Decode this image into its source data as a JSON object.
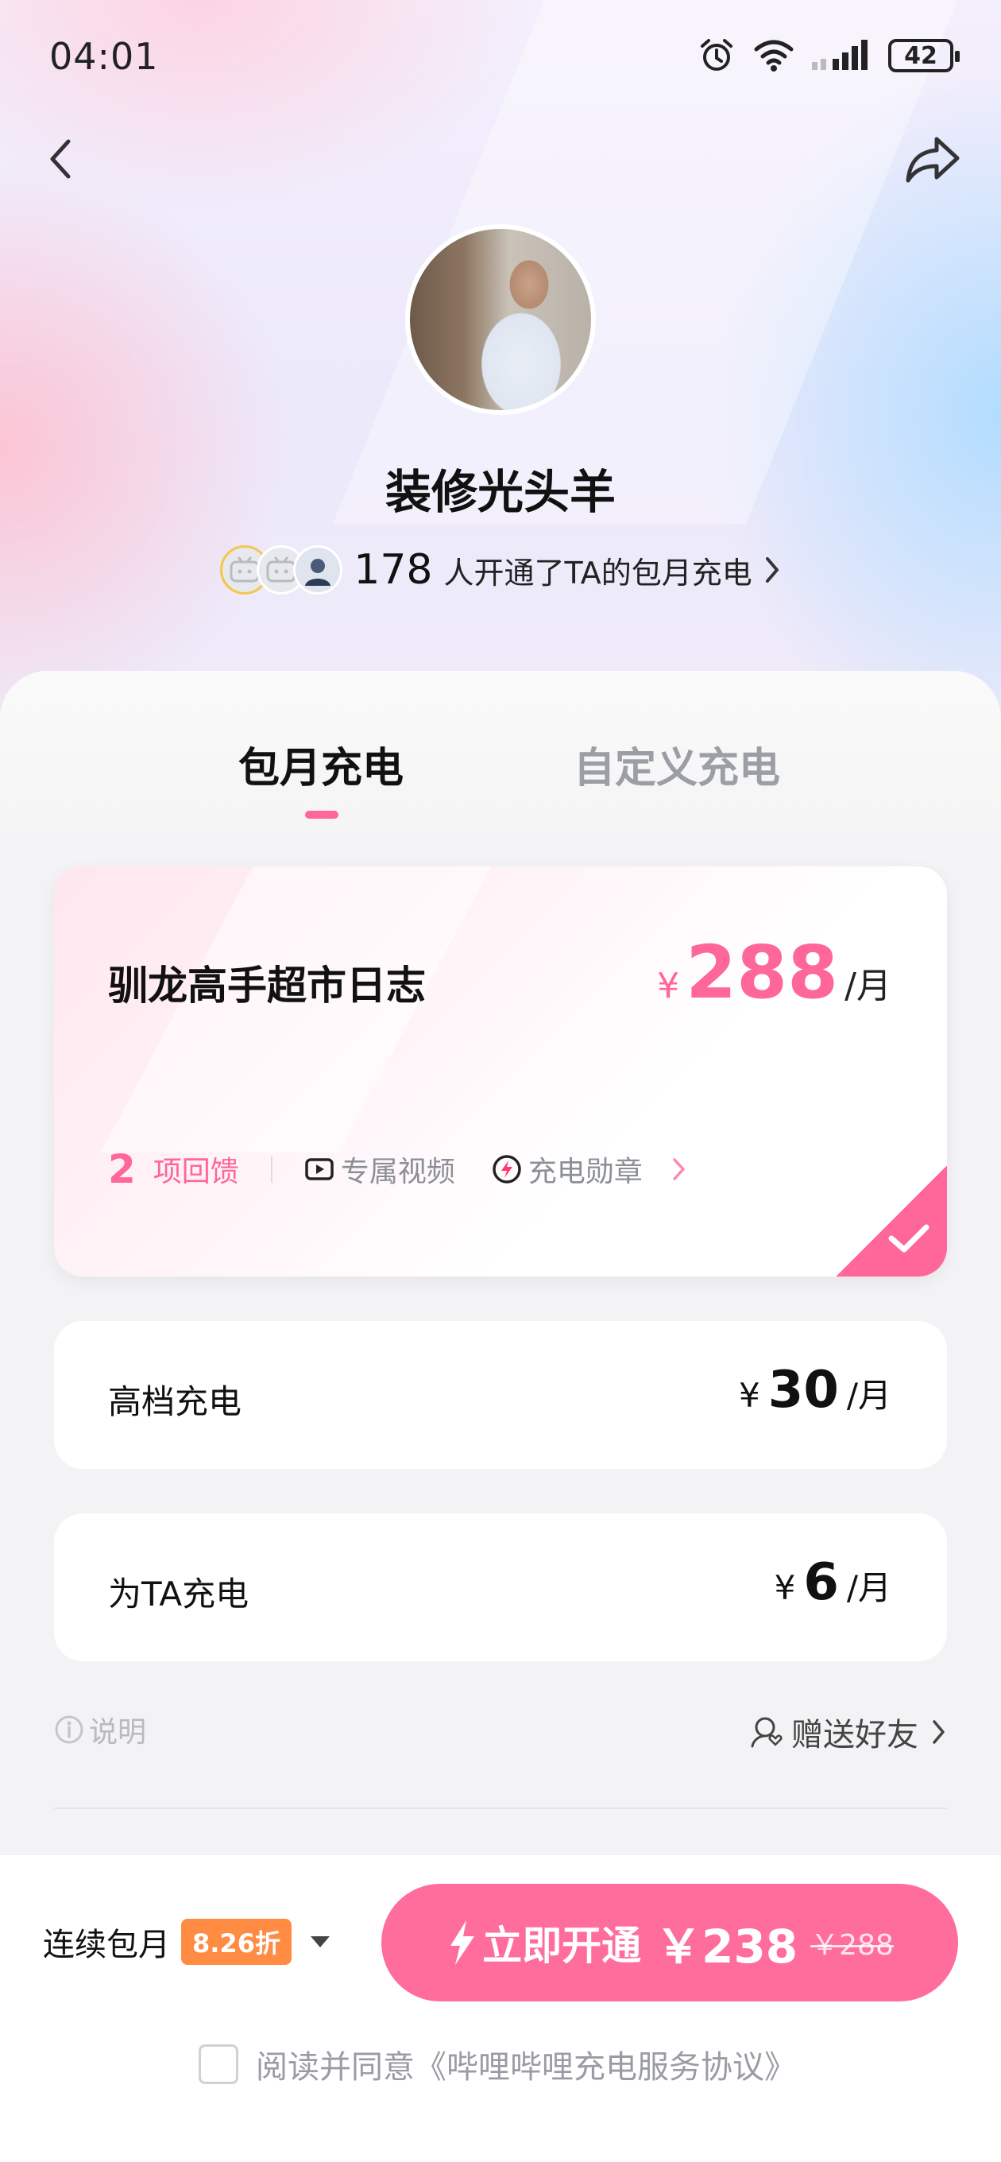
{
  "status_bar": {
    "time": "04:01",
    "battery": "42"
  },
  "creator": {
    "name": "装修光头羊"
  },
  "supporters": {
    "count": "178",
    "text": "人开通了TA的包月充电"
  },
  "tabs": [
    {
      "label": "包月充电"
    },
    {
      "label": "自定义充电"
    }
  ],
  "selected_plan": {
    "title": "驯龙高手超市日志",
    "currency": "¥",
    "price": "288",
    "unit": "/月",
    "perk_count": "2",
    "perk_label": "项回馈",
    "perks": [
      "专属视频",
      "充电勋章"
    ]
  },
  "plans": [
    {
      "label": "高档充电",
      "currency": "¥",
      "price": "30",
      "unit": "/月"
    },
    {
      "label": "为TA充电",
      "currency": "¥",
      "price": "6",
      "unit": "/月"
    }
  ],
  "info": {
    "explain": "说明",
    "gift": "赠送好友"
  },
  "footer": {
    "renew_label": "连续包月",
    "discount": "8.26折",
    "cta_text": "立即开通",
    "cta_price": "￥238",
    "cta_old_price": "￥288",
    "agree_text": "阅读并同意《哔哩哔哩充电服务协议》"
  },
  "colors": {
    "accent": "#ff6699",
    "cta": "#ff6d9c",
    "discount": "#ff8c42"
  }
}
